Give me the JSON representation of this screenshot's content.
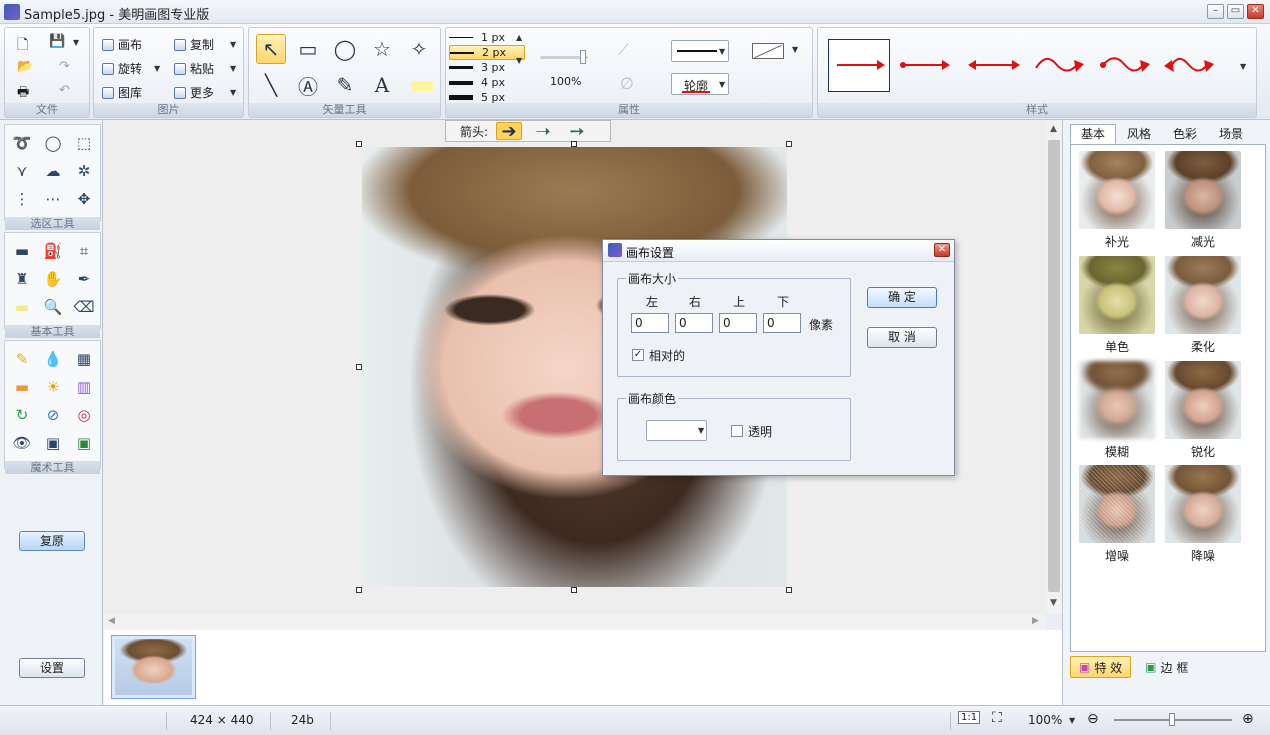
{
  "window": {
    "title": "Sample5.jpg - 美明画图专业版",
    "min_icon": "minimize-icon",
    "max_icon": "maximize-icon",
    "close_icon": "close-icon"
  },
  "ribbon": {
    "file": {
      "label": "文件"
    },
    "picture": {
      "label": "图片",
      "canvas": "画布",
      "copy": "复制",
      "rotate": "旋转",
      "paste": "粘贴",
      "gallery": "图库",
      "more": "更多"
    },
    "vector": {
      "label": "矢量工具"
    },
    "attributes": {
      "label": "属性",
      "widths": [
        "1 px",
        "2 px",
        "3 px",
        "4 px",
        "5 px"
      ],
      "selected_width": "2 px",
      "zoom": "100%",
      "outline": "轮廓"
    },
    "styles": {
      "label": "样式"
    }
  },
  "arrowbar": {
    "label": "箭头:"
  },
  "left": {
    "select_label": "选区工具",
    "basic_label": "基本工具",
    "magic_label": "魔术工具",
    "restore": "复原",
    "settings": "设置"
  },
  "right": {
    "tabs": [
      "基本",
      "风格",
      "色彩",
      "场景"
    ],
    "effects": [
      "补光",
      "减光",
      "单色",
      "柔化",
      "模糊",
      "锐化",
      "增噪",
      "降噪"
    ],
    "effects_tab": "特 效",
    "border_tab": "边 框"
  },
  "dialog": {
    "title": "画布设置",
    "size_group": "画布大小",
    "cols": [
      "左",
      "右",
      "上",
      "下"
    ],
    "values": [
      "0",
      "0",
      "0",
      "0"
    ],
    "unit": "像素",
    "relative": "相对的",
    "color_group": "画布颜色",
    "transparent": "透明",
    "ok": "确 定",
    "cancel": "取 消"
  },
  "status": {
    "dimensions": "424 × 440",
    "depth": "24b",
    "ratio": "1:1",
    "zoom": "100%"
  },
  "colors": {
    "accent": "#ffd66b",
    "arrow": "#e01010",
    "selection": "#3c7fd1"
  }
}
